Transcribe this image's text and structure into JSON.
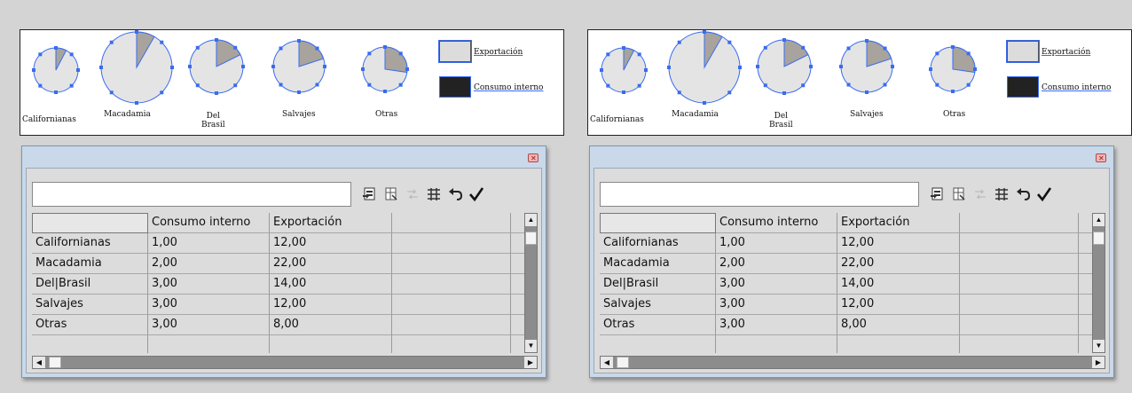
{
  "panels": [
    {
      "legend": [
        {
          "label": "Exportación",
          "color": "#d8d8d8"
        },
        {
          "label": "Consumo interno",
          "color": "#222222"
        }
      ],
      "charts": [
        {
          "name": "Californianas",
          "slice_fraction": 0.0769
        },
        {
          "name": "Macadamia",
          "slice_fraction": 0.0833
        },
        {
          "name": "Del\nBrasil",
          "slice_fraction": 0.1765
        },
        {
          "name": "Salvajes",
          "slice_fraction": 0.2
        },
        {
          "name": "Otras",
          "slice_fraction": 0.2727
        }
      ],
      "table": {
        "input_value": "",
        "toolbar_icons": [
          "import-data-icon",
          "transpose-icon",
          "switch-xy-icon",
          "cell-style-icon",
          "revert-icon",
          "apply-checkmark-icon"
        ],
        "headers": [
          "",
          "Consumo interno",
          "Exportación",
          "",
          ""
        ],
        "rows": [
          [
            "Californianas",
            "1,00",
            "12,00",
            "",
            ""
          ],
          [
            "Macadamia",
            "2,00",
            "22,00",
            "",
            ""
          ],
          [
            "Del|Brasil",
            "3,00",
            "14,00",
            "",
            ""
          ],
          [
            "Salvajes",
            "3,00",
            "12,00",
            "",
            ""
          ],
          [
            "Otras",
            "3,00",
            "8,00",
            "",
            ""
          ],
          [
            "",
            "",
            "",
            "",
            ""
          ]
        ]
      }
    },
    {
      "legend": [
        {
          "label": "Exportación",
          "color": "#d8d8d8"
        },
        {
          "label": "Consumo interno",
          "color": "#222222"
        }
      ],
      "charts": [
        {
          "name": "Californianas",
          "slice_fraction": 0.0769
        },
        {
          "name": "Macadamia",
          "slice_fraction": 0.0833
        },
        {
          "name": "Del\nBrasil",
          "slice_fraction": 0.1765
        },
        {
          "name": "Salvajes",
          "slice_fraction": 0.2
        },
        {
          "name": "Otras",
          "slice_fraction": 0.2727
        }
      ],
      "table": {
        "input_value": "",
        "toolbar_icons": [
          "import-data-icon",
          "transpose-icon",
          "switch-xy-icon",
          "cell-style-icon",
          "revert-icon",
          "apply-checkmark-icon"
        ],
        "headers": [
          "",
          "Consumo interno",
          "Exportación",
          "",
          ""
        ],
        "rows": [
          [
            "Californianas",
            "1,00",
            "12,00",
            "",
            ""
          ],
          [
            "Macadamia",
            "2,00",
            "22,00",
            "",
            ""
          ],
          [
            "Del|Brasil",
            "3,00",
            "14,00",
            "",
            ""
          ],
          [
            "Salvajes",
            "3,00",
            "12,00",
            "",
            ""
          ],
          [
            "Otras",
            "3,00",
            "8,00",
            "",
            ""
          ],
          [
            "",
            "",
            "",
            "",
            ""
          ]
        ]
      }
    }
  ],
  "colors": {
    "slice": "#a8a39c",
    "pie_fill": "#e4e4e4",
    "selection": "#3a6cf0"
  }
}
